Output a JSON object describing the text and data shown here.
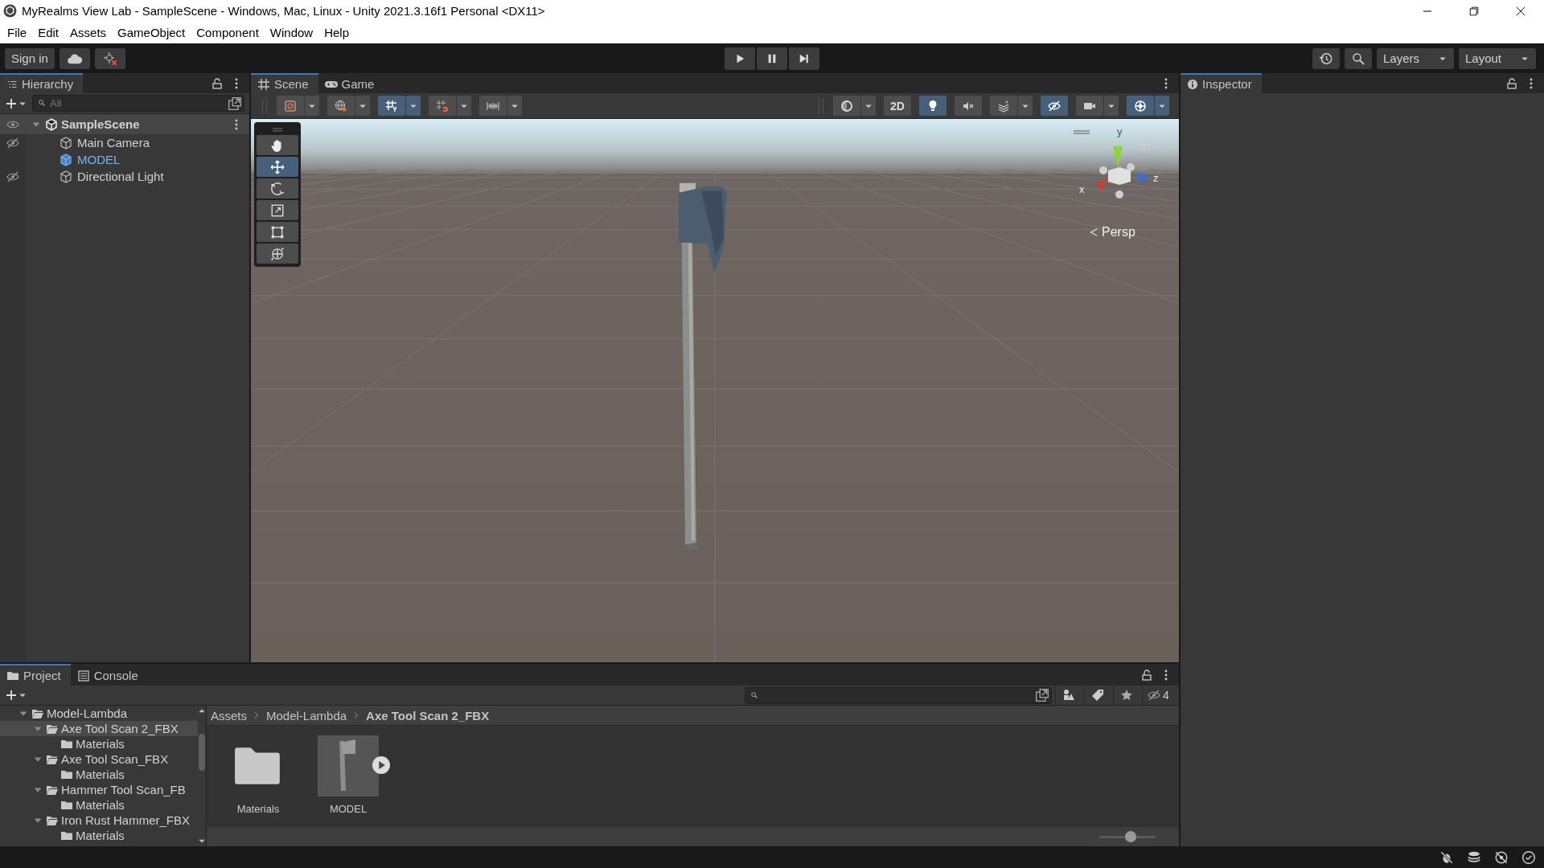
{
  "window": {
    "title": "MyRealms View Lab - SampleScene - Windows, Mac, Linux - Unity 2021.3.16f1 Personal <DX11>"
  },
  "menu": [
    "File",
    "Edit",
    "Assets",
    "GameObject",
    "Component",
    "Window",
    "Help"
  ],
  "toolbar": {
    "sign_in": "Sign in",
    "layers": "Layers",
    "layout": "Layout"
  },
  "hierarchy": {
    "tab": "Hierarchy",
    "search": {
      "placeholder": "All"
    },
    "scene": {
      "name": "SampleScene",
      "expanded": true,
      "children": [
        {
          "name": "Main Camera",
          "kind": "object",
          "hidden": true
        },
        {
          "name": "MODEL",
          "kind": "prefab",
          "hidden": false
        },
        {
          "name": "Directional Light",
          "kind": "object",
          "hidden": true
        }
      ]
    }
  },
  "scene_view": {
    "tabs": [
      {
        "label": "Scene",
        "kind": "scene",
        "selected": true
      },
      {
        "label": "Game",
        "kind": "game",
        "selected": false
      }
    ],
    "left_toggles": [
      {
        "kind": "draw-mode",
        "on": false
      },
      {
        "kind": "global",
        "on": false
      },
      {
        "kind": "grid-snap",
        "on": true
      },
      {
        "kind": "increment-snap",
        "on": false
      },
      {
        "kind": "ruler",
        "on": false
      }
    ],
    "right_toggles": [
      {
        "kind": "shading",
        "on": false
      },
      {
        "kind": "two-d",
        "label": "2D",
        "on": false
      },
      {
        "kind": "lighting",
        "on": true
      },
      {
        "kind": "audio",
        "on": false
      },
      {
        "kind": "effects",
        "on": false
      },
      {
        "kind": "hidden",
        "on": true
      },
      {
        "kind": "camera",
        "on": false
      },
      {
        "kind": "gizmos",
        "on": true
      }
    ],
    "tools": [
      {
        "kind": "hand",
        "selected": false
      },
      {
        "kind": "move",
        "selected": true
      },
      {
        "kind": "rotate",
        "selected": false
      },
      {
        "kind": "scale",
        "selected": false
      },
      {
        "kind": "rect",
        "selected": false
      },
      {
        "kind": "transform",
        "selected": false
      }
    ],
    "gizmo": {
      "x": "x",
      "y": "y",
      "z": "z"
    },
    "projection": "Persp"
  },
  "inspector": {
    "tab": "Inspector"
  },
  "project": {
    "tabs": [
      {
        "label": "Project",
        "kind": "project",
        "selected": true
      },
      {
        "label": "Console",
        "kind": "console",
        "selected": false
      }
    ],
    "tree": [
      {
        "name": "Model-Lambda",
        "expanded": true,
        "selected": false,
        "children": [
          {
            "name": "Axe Tool Scan 2_FBX",
            "expanded": true,
            "selected": true,
            "children": [
              {
                "name": "Materials",
                "selected": false
              }
            ]
          },
          {
            "name": "Axe Tool Scan_FBX",
            "expanded": true,
            "selected": false,
            "children": [
              {
                "name": "Materials",
                "selected": false
              }
            ]
          },
          {
            "name": "Hammer Tool Scan_FB",
            "expanded": true,
            "selected": false,
            "children": [
              {
                "name": "Materials",
                "selected": false
              }
            ]
          },
          {
            "name": "Iron Rust Hammer_FBX",
            "expanded": true,
            "selected": false,
            "children": [
              {
                "name": "Materials",
                "selected": false
              }
            ]
          }
        ]
      }
    ],
    "breadcrumb": [
      "Assets",
      "Model-Lambda",
      "Axe Tool Scan 2_FBX"
    ],
    "assets": [
      {
        "name": "Materials",
        "kind": "folder"
      },
      {
        "name": "MODEL",
        "kind": "model"
      }
    ],
    "hidden_count": "4",
    "zoom": {
      "level": 0.55
    }
  }
}
